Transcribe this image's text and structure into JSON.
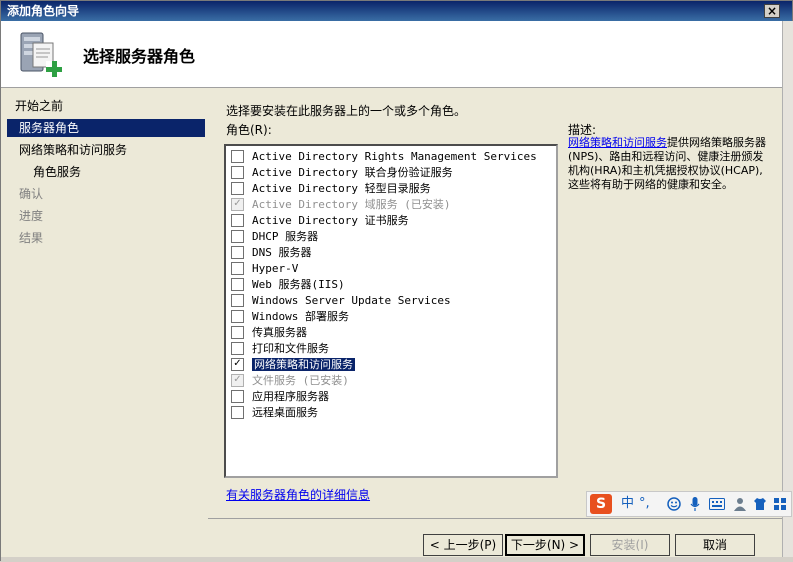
{
  "window": {
    "title": "添加角色向导",
    "close_label": "×"
  },
  "header": {
    "heading": "选择服务器角色"
  },
  "nav": {
    "items": [
      {
        "label": "开始之前",
        "state": "normal"
      },
      {
        "label": "服务器角色",
        "state": "selected"
      },
      {
        "label": "网络策略和访问服务",
        "state": "normal"
      },
      {
        "label": "角色服务",
        "state": "normal"
      },
      {
        "label": "确认",
        "state": "disabled"
      },
      {
        "label": "进度",
        "state": "disabled"
      },
      {
        "label": "结果",
        "state": "disabled"
      }
    ]
  },
  "main": {
    "instruction": "选择要安装在此服务器上的一个或多个角色。",
    "roles_label": "角色(R):",
    "description_label": "描述:",
    "roles": [
      {
        "label": "Active Directory Rights Management Services",
        "checked": false,
        "disabled": false
      },
      {
        "label": "Active Directory 联合身份验证服务",
        "checked": false,
        "disabled": false
      },
      {
        "label": "Active Directory 轻型目录服务",
        "checked": false,
        "disabled": false
      },
      {
        "label": "Active Directory 域服务  (已安装)",
        "checked": true,
        "disabled": true
      },
      {
        "label": "Active Directory 证书服务",
        "checked": false,
        "disabled": false
      },
      {
        "label": "DHCP 服务器",
        "checked": false,
        "disabled": false
      },
      {
        "label": "DNS 服务器",
        "checked": false,
        "disabled": false
      },
      {
        "label": "Hyper-V",
        "checked": false,
        "disabled": false
      },
      {
        "label": "Web 服务器(IIS)",
        "checked": false,
        "disabled": false
      },
      {
        "label": "Windows Server Update Services",
        "checked": false,
        "disabled": false
      },
      {
        "label": "Windows 部署服务",
        "checked": false,
        "disabled": false
      },
      {
        "label": "传真服务器",
        "checked": false,
        "disabled": false
      },
      {
        "label": "打印和文件服务",
        "checked": false,
        "disabled": false
      },
      {
        "label": "网络策略和访问服务",
        "checked": true,
        "disabled": false,
        "selected": true
      },
      {
        "label": "文件服务  (已安装)",
        "checked": true,
        "disabled": true
      },
      {
        "label": "应用程序服务器",
        "checked": false,
        "disabled": false
      },
      {
        "label": "远程桌面服务",
        "checked": false,
        "disabled": false
      }
    ],
    "description_link": "网络策略和访问服务",
    "description_text": "提供网络策略服务器(NPS)、路由和远程访问、健康注册颁发机构(HRA)和主机凭据授权协议(HCAP),这些将有助于网络的健康和安全。",
    "more_info_link": "有关服务器角色的详细信息"
  },
  "buttons": {
    "back": "< 上一步(P)",
    "next": "下一步(N) >",
    "install": "安装(I)",
    "cancel": "取消"
  },
  "ime": {
    "logo": "S",
    "mode": "中",
    "punct": "°,",
    "icons": [
      "smiley-icon",
      "microphone-icon",
      "keyboard-icon",
      "user-icon",
      "shirt-icon",
      "grid-icon"
    ]
  },
  "colors": {
    "selection": "#0a246a",
    "link": "#0000ee",
    "ime_logo": "#e8501f"
  }
}
